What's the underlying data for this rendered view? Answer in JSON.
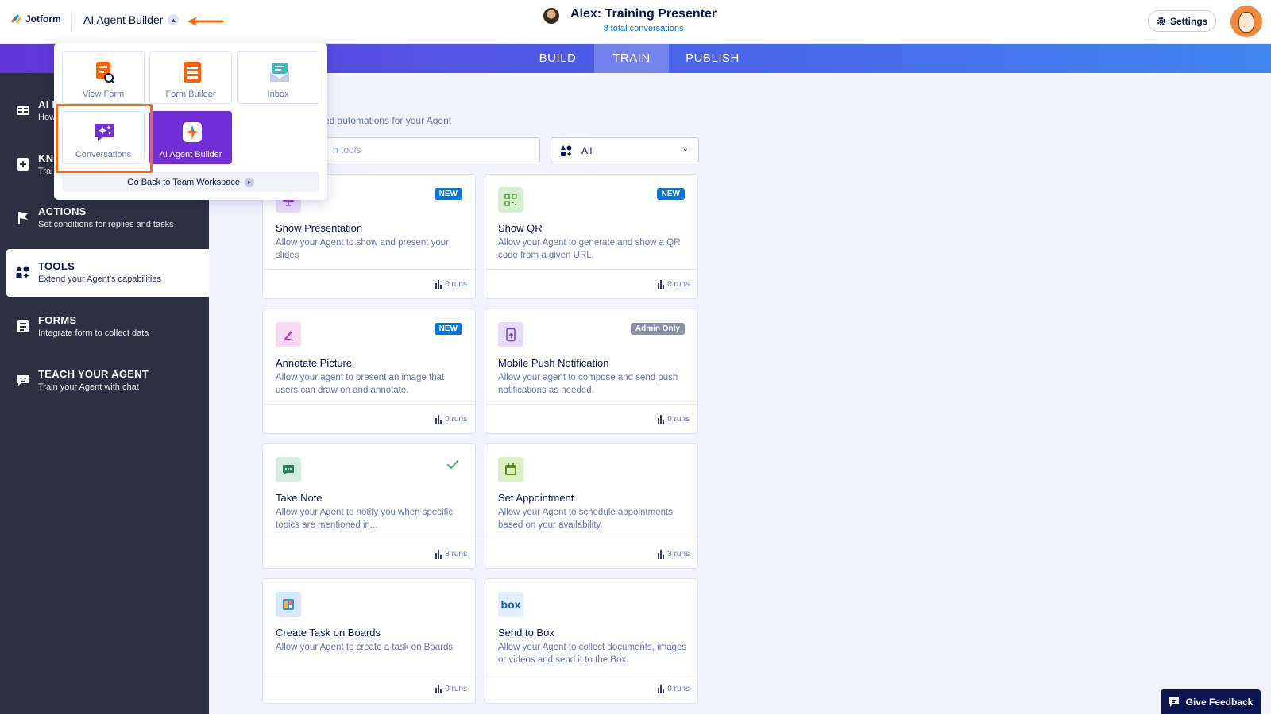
{
  "header": {
    "logo_text": "Jotform",
    "app_switcher_label": "AI Agent Builder",
    "agent_name": "Alex: Training Presenter",
    "agent_subtitle": "8 total conversations",
    "settings_label": "Settings"
  },
  "tabs": [
    {
      "label": "BUILD",
      "active": false
    },
    {
      "label": "TRAIN",
      "active": true
    },
    {
      "label": "PUBLISH",
      "active": false
    }
  ],
  "sidebar": {
    "items": [
      {
        "title": "AI P",
        "desc": "How",
        "icon": "id-card-icon"
      },
      {
        "title": "KN",
        "desc": "Trai",
        "icon": "book-plus-icon"
      },
      {
        "title": "ACTIONS",
        "desc": "Set conditions for replies and tasks",
        "icon": "flag-icon"
      },
      {
        "title": "TOOLS",
        "desc": "Extend your Agent's capabilities",
        "icon": "tools-grid-icon",
        "active": true
      },
      {
        "title": "FORMS",
        "desc": "Integrate form to collect data",
        "icon": "form-icon"
      },
      {
        "title": "TEACH YOUR AGENT",
        "desc": "Train your Agent with chat",
        "icon": "chat-smile-icon"
      }
    ]
  },
  "main": {
    "title_fragment": "S",
    "subtitle_fragment": "sed automations for your Agent",
    "search_placeholder": "n tools",
    "filter_value": "All"
  },
  "cards": [
    {
      "title": "Show Presentation",
      "desc": "Allow your Agent to show and present your slides",
      "runs": "0 runs",
      "badge": "NEW",
      "badge_type": "new",
      "icon": "presentation-icon",
      "icon_bg": "#eadcfb"
    },
    {
      "title": "Show QR",
      "desc": "Allow your Agent to generate and show a QR code from a given URL.",
      "runs": "0 runs",
      "badge": "NEW",
      "badge_type": "new",
      "icon": "qr-code-icon",
      "icon_bg": "#d8eed3"
    },
    {
      "title": "Annotate Picture",
      "desc": "Allow your agent to present an image that users can draw on and annotate.",
      "runs": "0 runs",
      "badge": "NEW",
      "badge_type": "new",
      "icon": "pencil-icon",
      "icon_bg": "#f6dcf2"
    },
    {
      "title": "Mobile Push Notification",
      "desc": "Allow your agent to compose and send push notifications as needed.",
      "runs": "0 runs",
      "badge": "Admin Only",
      "badge_type": "admin",
      "icon": "phone-bell-icon",
      "icon_bg": "#e6dcf8"
    },
    {
      "title": "Take Note",
      "desc": "Allow your Agent to notify you when specific topics are mentioned in...",
      "runs": "3 runs",
      "badge": "",
      "badge_type": "check",
      "icon": "note-chat-icon",
      "icon_bg": "#d3ede0"
    },
    {
      "title": "Set Appointment",
      "desc": "Allow your Agent to schedule appointments based on your availability.",
      "runs": "3 runs",
      "badge": "",
      "badge_type": "",
      "icon": "calendar-icon",
      "icon_bg": "#dcefc4"
    },
    {
      "title": "Create Task on Boards",
      "desc": "Allow your Agent to create a task on Boards",
      "runs": "0 runs",
      "badge": "",
      "badge_type": "",
      "icon": "boards-icon",
      "icon_bg": "#d6e8fb"
    },
    {
      "title": "Send to Box",
      "desc": "Allow your Agent to collect documents, images or videos and send it to the Box.",
      "runs": "0 runs",
      "badge": "",
      "badge_type": "",
      "icon": "box-logo-icon",
      "icon_bg": "#e4edfb",
      "icon_text": "box"
    }
  ],
  "dropdown": {
    "tiles": [
      {
        "label": "View Form",
        "icon": "view-form-icon"
      },
      {
        "label": "Form Builder",
        "icon": "form-builder-icon"
      },
      {
        "label": "Inbox",
        "icon": "inbox-icon"
      },
      {
        "label": "Conversations",
        "icon": "conversations-icon"
      },
      {
        "label": "AI Agent Builder",
        "icon": "ai-agent-builder-icon",
        "active": true
      }
    ],
    "footer_label": "Go Back to Team Workspace"
  },
  "feedback_label": "Give Feedback",
  "colors": {
    "brand_purple": "#6f2ed6",
    "navy": "#0a1551",
    "accent_blue": "#0075e3",
    "highlight_orange": "#f46b12",
    "sidebar_bg": "#2d3040"
  }
}
